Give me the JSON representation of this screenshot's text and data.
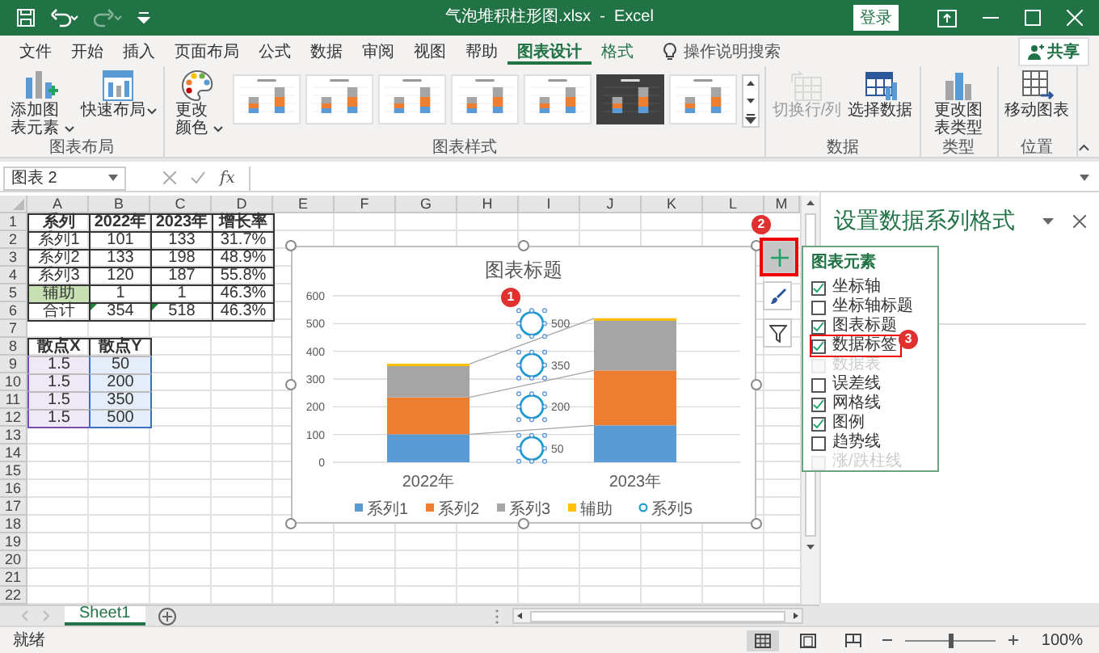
{
  "window": {
    "title": "气泡堆积柱形图.xlsx  -  Excel",
    "sign_in": "登录",
    "redo": {
      "disabled": true
    }
  },
  "menu_tabs": [
    {
      "label": "文件",
      "selected": false,
      "contextual": false
    },
    {
      "label": "开始",
      "selected": false,
      "contextual": false
    },
    {
      "label": "插入",
      "selected": false,
      "contextual": false
    },
    {
      "label": "页面布局",
      "selected": false,
      "contextual": false
    },
    {
      "label": "公式",
      "selected": false,
      "contextual": false
    },
    {
      "label": "数据",
      "selected": false,
      "contextual": false
    },
    {
      "label": "审阅",
      "selected": false,
      "contextual": false
    },
    {
      "label": "视图",
      "selected": false,
      "contextual": false
    },
    {
      "label": "帮助",
      "selected": false,
      "contextual": false
    },
    {
      "label": "图表设计",
      "selected": true,
      "contextual": true
    },
    {
      "label": "格式",
      "selected": false,
      "contextual": true
    }
  ],
  "tell_me": "操作说明搜索",
  "share": "共享",
  "ribbon": {
    "groups": [
      {
        "label": "图表布局",
        "buttons": [
          {
            "label": "添加图表元素",
            "dropdown": true,
            "disabled": false
          },
          {
            "label": "快速布局",
            "dropdown": true,
            "disabled": false
          }
        ]
      },
      {
        "label": "图表样式",
        "buttons": [
          {
            "label": "更改颜色",
            "dropdown": true,
            "disabled": false
          }
        ],
        "gallery": [
          {
            "kind": "light"
          },
          {
            "kind": "light"
          },
          {
            "kind": "light"
          },
          {
            "kind": "light"
          },
          {
            "kind": "light"
          },
          {
            "kind": "dark"
          },
          {
            "kind": "light"
          }
        ]
      },
      {
        "label": "数据",
        "buttons": [
          {
            "label": "切换行/列",
            "dropdown": false,
            "disabled": true
          },
          {
            "label": "选择数据",
            "dropdown": false,
            "disabled": false
          }
        ]
      },
      {
        "label": "类型",
        "buttons": [
          {
            "label": "更改图表类型",
            "dropdown": false,
            "disabled": false
          }
        ]
      },
      {
        "label": "位置",
        "buttons": [
          {
            "label": "移动图表",
            "dropdown": false,
            "disabled": false
          }
        ]
      }
    ]
  },
  "name_box": "图表 2",
  "function_label": "fx",
  "sheet": {
    "columns": [
      "A",
      "B",
      "C",
      "D",
      "E",
      "F",
      "G",
      "H",
      "I",
      "J",
      "K",
      "L",
      "M"
    ],
    "rows": [
      {
        "number": "1",
        "cells": [
          {
            "text": "系列",
            "kind": "header"
          },
          {
            "text": "2022年",
            "kind": "header"
          },
          {
            "text": "2023年",
            "kind": "header"
          },
          {
            "text": "增长率",
            "kind": "header"
          }
        ]
      },
      {
        "number": "2",
        "cells": [
          {
            "text": "系列1",
            "kind": "value"
          },
          {
            "text": "101",
            "kind": "value"
          },
          {
            "text": "133",
            "kind": "value"
          },
          {
            "text": "31.7%",
            "kind": "value"
          }
        ]
      },
      {
        "number": "3",
        "cells": [
          {
            "text": "系列2",
            "kind": "value"
          },
          {
            "text": "133",
            "kind": "value"
          },
          {
            "text": "198",
            "kind": "value"
          },
          {
            "text": "48.9%",
            "kind": "value"
          }
        ]
      },
      {
        "number": "4",
        "cells": [
          {
            "text": "系列3",
            "kind": "value"
          },
          {
            "text": "120",
            "kind": "value"
          },
          {
            "text": "187",
            "kind": "value"
          },
          {
            "text": "55.8%",
            "kind": "value"
          }
        ]
      },
      {
        "number": "5",
        "cells": [
          {
            "text": "辅助",
            "kind": "helper"
          },
          {
            "text": "1",
            "kind": "value"
          },
          {
            "text": "1",
            "kind": "value"
          },
          {
            "text": "46.3%",
            "kind": "value"
          }
        ]
      },
      {
        "number": "6",
        "cells": [
          {
            "text": "合计",
            "kind": "value"
          },
          {
            "text": "354",
            "kind": "flagged"
          },
          {
            "text": "518",
            "kind": "flagged"
          },
          {
            "text": "46.3%",
            "kind": "value"
          }
        ]
      },
      {
        "number": "7"
      },
      {
        "number": "8",
        "cells": [
          {
            "text": "散点X",
            "kind": "header"
          },
          {
            "text": "散点Y",
            "kind": "header"
          }
        ]
      },
      {
        "number": "9",
        "cells": [
          {
            "text": "1.5",
            "kind": "x"
          },
          {
            "text": "50",
            "kind": "y"
          }
        ]
      },
      {
        "number": "10",
        "cells": [
          {
            "text": "1.5",
            "kind": "x"
          },
          {
            "text": "200",
            "kind": "y"
          }
        ]
      },
      {
        "number": "11",
        "cells": [
          {
            "text": "1.5",
            "kind": "x"
          },
          {
            "text": "350",
            "kind": "y"
          }
        ]
      },
      {
        "number": "12",
        "cells": [
          {
            "text": "1.5",
            "kind": "x"
          },
          {
            "text": "500",
            "kind": "y"
          }
        ]
      },
      {
        "number": "13"
      },
      {
        "number": "14"
      },
      {
        "number": "15"
      },
      {
        "number": "16"
      },
      {
        "number": "17"
      },
      {
        "number": "18"
      },
      {
        "number": "19"
      },
      {
        "number": "20"
      },
      {
        "number": "21"
      },
      {
        "number": "22"
      }
    ]
  },
  "chart": {
    "chart_data": {
      "type": "bar",
      "title": "图表标题",
      "categories": [
        "2022年",
        "2023年"
      ],
      "stacked": true,
      "orientation": "vertical",
      "ylim": [
        0,
        600
      ],
      "yticks": [
        0,
        100,
        200,
        300,
        400,
        500,
        600
      ],
      "series": [
        {
          "name": "系列1",
          "color": "#5b9bd5",
          "values": [
            101,
            133
          ]
        },
        {
          "name": "系列2",
          "color": "#ed7d31",
          "values": [
            133,
            198
          ]
        },
        {
          "name": "系列3",
          "color": "#a5a5a5",
          "values": [
            120,
            187
          ]
        },
        {
          "name": "辅助",
          "color": "#ffc000",
          "values": [
            1,
            1
          ]
        }
      ],
      "grid": true,
      "legend": true,
      "annotations": [
        "500",
        "350",
        "200",
        "50"
      ]
    },
    "scatter_series": {
      "name": "系列5",
      "color": "#1f9bcf"
    },
    "tools": [
      {
        "kind": "add",
        "highlighted": true
      },
      {
        "kind": "style",
        "highlighted": false
      },
      {
        "kind": "filter",
        "highlighted": false
      }
    ]
  },
  "elements_panel": {
    "title": "图表元素",
    "items": [
      {
        "label": "坐标轴",
        "checked": true,
        "disabled": false,
        "highlighted": false
      },
      {
        "label": "坐标轴标题",
        "checked": false,
        "disabled": false,
        "highlighted": false
      },
      {
        "label": "图表标题",
        "checked": true,
        "disabled": false,
        "highlighted": false
      },
      {
        "label": "数据标签",
        "checked": true,
        "disabled": false,
        "highlighted": true
      },
      {
        "label": "数据表",
        "checked": false,
        "disabled": true,
        "highlighted": false
      },
      {
        "label": "误差线",
        "checked": false,
        "disabled": false,
        "highlighted": false
      },
      {
        "label": "网格线",
        "checked": true,
        "disabled": false,
        "highlighted": false
      },
      {
        "label": "图例",
        "checked": true,
        "disabled": false,
        "highlighted": false
      },
      {
        "label": "趋势线",
        "checked": false,
        "disabled": false,
        "highlighted": false
      },
      {
        "label": "涨/跌柱线",
        "checked": false,
        "disabled": true,
        "highlighted": false
      }
    ]
  },
  "callouts": [
    "1",
    "2",
    "3"
  ],
  "pane": {
    "title": "设置数据系列格式"
  },
  "sheet_tabs": [
    {
      "label": "Sheet1",
      "selected": true
    }
  ],
  "status_bar": {
    "text": "就绪",
    "views": [
      {
        "kind": "normal",
        "selected": true
      },
      {
        "kind": "page-layout",
        "selected": false
      },
      {
        "kind": "page-break",
        "selected": false
      }
    ],
    "zoom": {
      "level": 0.5,
      "text": "100%"
    }
  }
}
